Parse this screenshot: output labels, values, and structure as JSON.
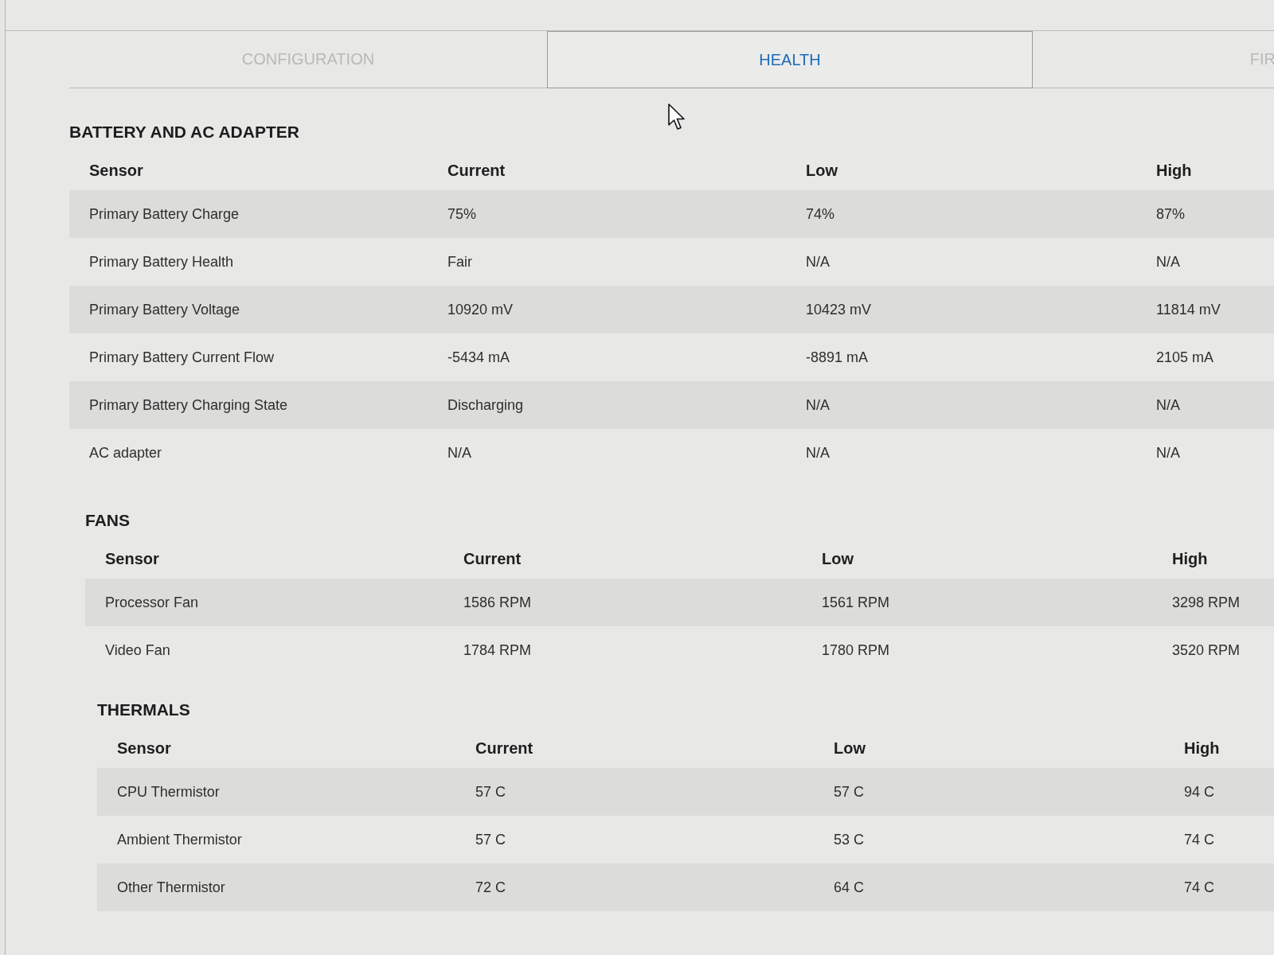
{
  "tabs": [
    {
      "label": "CONFIGURATION",
      "selected": false
    },
    {
      "label": "HEALTH",
      "selected": true
    },
    {
      "label": "FIR",
      "selected": false
    }
  ],
  "sections": [
    {
      "title": "BATTERY AND AC ADAPTER",
      "columns": [
        "Sensor",
        "Current",
        "Low",
        "High"
      ],
      "rows": [
        [
          "Primary Battery Charge",
          "75%",
          "74%",
          "87%"
        ],
        [
          "Primary Battery Health",
          "Fair",
          "N/A",
          "N/A"
        ],
        [
          "Primary Battery Voltage",
          "10920 mV",
          "10423 mV",
          "11814 mV"
        ],
        [
          "Primary Battery Current Flow",
          "-5434 mA",
          "-8891 mA",
          "2105 mA"
        ],
        [
          "Primary Battery Charging State",
          "Discharging",
          "N/A",
          "N/A"
        ],
        [
          "AC adapter",
          "N/A",
          "N/A",
          "N/A"
        ]
      ]
    },
    {
      "title": "FANS",
      "columns": [
        "Sensor",
        "Current",
        "Low",
        "High"
      ],
      "rows": [
        [
          "Processor Fan",
          "1586 RPM",
          "1561 RPM",
          "3298 RPM"
        ],
        [
          "Video Fan",
          "1784 RPM",
          "1780 RPM",
          "3520 RPM"
        ]
      ]
    },
    {
      "title": "THERMALS",
      "columns": [
        "Sensor",
        "Current",
        "Low",
        "High"
      ],
      "rows": [
        [
          "CPU Thermistor",
          "57 C",
          "57 C",
          "94 C"
        ],
        [
          "Ambient Thermistor",
          "57 C",
          "53 C",
          "74 C"
        ],
        [
          "Other Thermistor",
          "72 C",
          "64 C",
          "74 C"
        ]
      ]
    }
  ]
}
